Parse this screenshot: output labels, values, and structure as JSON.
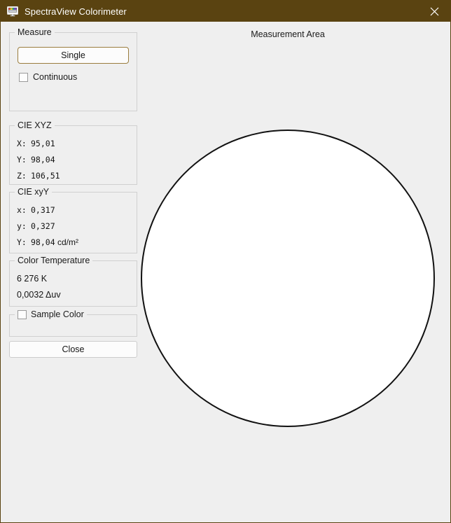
{
  "window": {
    "title": "SpectraView Colorimeter",
    "icon": "monitor-color-icon",
    "close_icon": "close-icon",
    "titlebar_color": "#5a4311",
    "background_color": "#efefef"
  },
  "measure_group": {
    "title": "Measure",
    "single_button": "Single",
    "continuous_checkbox": "Continuous",
    "accent_color": "#9b7d3e"
  },
  "cie_xyz": {
    "title": "CIE XYZ",
    "rows": [
      {
        "label": "X:",
        "value": "95,01"
      },
      {
        "label": "Y:",
        "value": "98,04"
      },
      {
        "label": "Z:",
        "value": "106,51"
      }
    ]
  },
  "cie_xyy": {
    "title": "CIE xyY",
    "rows": [
      {
        "label": "x:",
        "value": "0,317",
        "unit": ""
      },
      {
        "label": "y:",
        "value": "0,327",
        "unit": ""
      },
      {
        "label": "Y:",
        "value": "98,04",
        "unit": " cd/m²"
      }
    ]
  },
  "color_temperature": {
    "title": "Color Temperature",
    "cct": "6 276 K",
    "duv": "0,0032 Δuv"
  },
  "sample_color": {
    "title": "Sample Color"
  },
  "close_button": {
    "label": "Close"
  },
  "measurement_area": {
    "label": "Measurement Area",
    "circle_fill": "#ffffff",
    "circle_stroke": "#111111"
  }
}
